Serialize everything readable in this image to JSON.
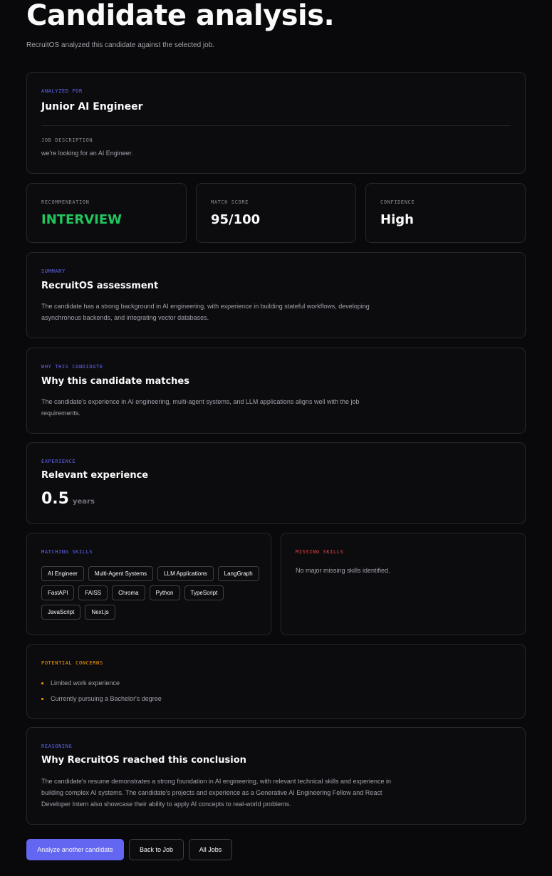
{
  "header": {
    "title": "Candidate analysis.",
    "subtitle": "RecruitOS analyzed this candidate against the selected job."
  },
  "job": {
    "analyzed_for_label": "ANALYZED FOR",
    "job_title": "Junior AI Engineer",
    "description_label": "JOB DESCRIPTION",
    "description": "we're looking for an AI Engineer."
  },
  "metrics": {
    "recommendation_label": "RECOMMENDATION",
    "recommendation": "INTERVIEW",
    "match_score_label": "MATCH SCORE",
    "match_score": "95/100",
    "confidence_label": "CONFIDENCE",
    "confidence": "High"
  },
  "summary": {
    "eyebrow": "SUMMARY",
    "title": "RecruitOS assessment",
    "text": "The candidate has a strong background in AI engineering, with experience in building stateful workflows, developing asynchronous backends, and integrating vector databases."
  },
  "why": {
    "eyebrow": "WHY THIS CANDIDATE",
    "title": "Why this candidate matches",
    "text": "The candidate's experience in AI engineering, multi-agent systems, and LLM applications aligns well with the job requirements."
  },
  "experience": {
    "eyebrow": "EXPERIENCE",
    "title": "Relevant experience",
    "value": "0.5",
    "unit": "years"
  },
  "skills": {
    "matching_label": "MATCHING SKILLS",
    "matching": [
      "AI Engineer",
      "Multi-Agent Systems",
      "LLM Applications",
      "LangGraph",
      "FastAPI",
      "FAISS",
      "Chroma",
      "Python",
      "TypeScript",
      "JavaScript",
      "Next.js"
    ],
    "missing_label": "MISSING SKILLS",
    "missing_text": "No major missing skills identified."
  },
  "concerns": {
    "eyebrow": "POTENTIAL CONCERNS",
    "items": [
      "Limited work experience",
      "Currently pursuing a Bachelor's degree"
    ]
  },
  "reasoning": {
    "eyebrow": "REASONING",
    "title": "Why RecruitOS reached this conclusion",
    "text": "The candidate's resume demonstrates a strong foundation in AI engineering, with relevant technical skills and experience in building complex AI systems. The candidate's projects and experience as a Generative AI Engineering Fellow and React Developer Intern also showcase their ability to apply AI concepts to real-world problems."
  },
  "actions": {
    "analyze_another": "Analyze another candidate",
    "back_to_job": "Back to Job",
    "all_jobs": "All Jobs"
  },
  "colors": {
    "accent": "#6366f1",
    "success": "#22c55e",
    "danger": "#ef4444",
    "warning": "#f59e0b",
    "background": "#09090b"
  }
}
